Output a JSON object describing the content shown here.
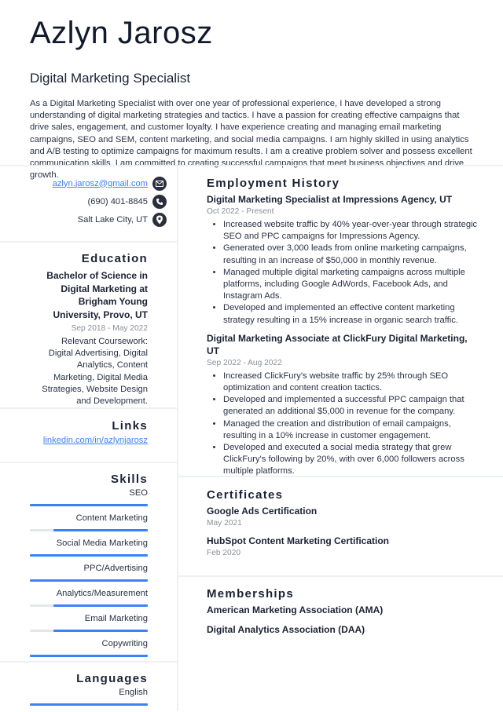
{
  "header": {
    "name": "Azlyn Jarosz",
    "job_title": "Digital Marketing Specialist",
    "summary": "As a Digital Marketing Specialist with over one year of professional experience, I have developed a strong understanding of digital marketing strategies and tactics. I have a passion for creating effective campaigns that drive sales, engagement, and customer loyalty. I have experience creating and managing email marketing campaigns, SEO and SEM, content marketing, and social media campaigns. I am highly skilled in using analytics and A/B testing to optimize campaigns for maximum results. I am a creative problem solver and possess excellent communication skills. I am committed to creating successful campaigns that meet business objectives and drive growth."
  },
  "contact": {
    "email": "azlyn.jarosz@gmail.com",
    "email_icon": "envelope-icon",
    "phone": "(690) 401-8845",
    "phone_icon": "phone-icon",
    "location": "Salt Lake City, UT",
    "location_icon": "map-pin-icon"
  },
  "education": {
    "title": "Education",
    "degree": "Bachelor of Science in Digital Marketing at Brigham Young University, Provo, UT",
    "dates": "Sep 2018 - May 2022",
    "coursework": "Relevant Coursework: Digital Advertising, Digital Analytics, Content Marketing, Digital Media Strategies, Website Design and Development."
  },
  "links": {
    "title": "Links",
    "items": [
      "linkedin.com/in/azlynjarosz"
    ]
  },
  "skills": {
    "title": "Skills",
    "items": [
      {
        "label": "SEO",
        "level": 1.0
      },
      {
        "label": "Content Marketing",
        "level": 0.8
      },
      {
        "label": "Social Media Marketing",
        "level": 1.0
      },
      {
        "label": "PPC/Advertising",
        "level": 1.0
      },
      {
        "label": "Analytics/Measurement",
        "level": 0.8
      },
      {
        "label": "Email Marketing",
        "level": 0.8
      },
      {
        "label": "Copywriting",
        "level": 1.0
      }
    ]
  },
  "languages": {
    "title": "Languages",
    "items": [
      {
        "label": "English",
        "level": 1.0
      }
    ]
  },
  "employment": {
    "title": "Employment History",
    "jobs": [
      {
        "title": "Digital Marketing Specialist at Impressions Agency, UT",
        "dates": "Oct 2022 - Present",
        "bullets": [
          "Increased website traffic by 40% year-over-year through strategic SEO and PPC campaigns for Impressions Agency.",
          "Generated over 3,000 leads from online marketing campaigns, resulting in an increase of $50,000 in monthly revenue.",
          "Managed multiple digital marketing campaigns across multiple platforms, including Google AdWords, Facebook Ads, and Instagram Ads.",
          "Developed and implemented an effective content marketing strategy resulting in a 15% increase in organic search traffic."
        ]
      },
      {
        "title": "Digital Marketing Associate at ClickFury Digital Marketing, UT",
        "dates": "Sep 2022 - Aug 2022",
        "bullets": [
          "Increased ClickFury's website traffic by 25% through SEO optimization and content creation tactics.",
          "Developed and implemented a successful PPC campaign that generated an additional $5,000 in revenue for the company.",
          "Managed the creation and distribution of email campaigns, resulting in a 10% increase in customer engagement.",
          "Developed and executed a social media strategy that grew ClickFury's following by 20%, with over 6,000 followers across multiple platforms."
        ]
      }
    ]
  },
  "certificates": {
    "title": "Certificates",
    "items": [
      {
        "name": "Google Ads Certification",
        "date": "May 2021"
      },
      {
        "name": "HubSpot Content Marketing Certification",
        "date": "Feb 2020"
      }
    ]
  },
  "memberships": {
    "title": "Memberships",
    "items": [
      "American Marketing Association (AMA)",
      "Digital Analytics Association (DAA)"
    ]
  },
  "colors": {
    "accent": "#3b82f6",
    "bar_track": "#e4e6ea",
    "text": "#1a2233",
    "muted": "#8a8f98"
  }
}
